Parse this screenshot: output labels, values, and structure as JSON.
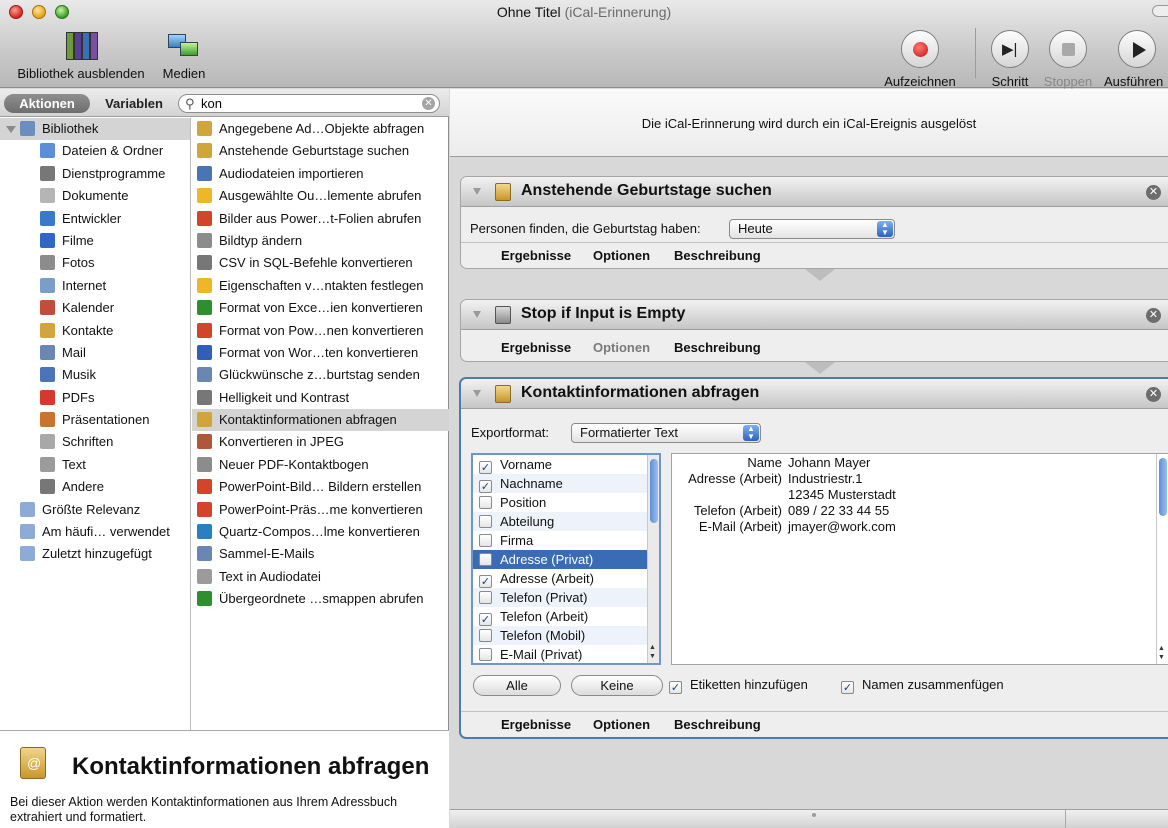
{
  "window": {
    "title": "Ohne Titel",
    "subtitle": "(iCal-Erinnerung)"
  },
  "toolbar": {
    "library_label": "Bibliothek ausblenden",
    "media_label": "Medien",
    "record_label": "Aufzeichnen",
    "step_label": "Schritt",
    "stop_label": "Stoppen",
    "run_label": "Ausführen"
  },
  "sidebar": {
    "tab_actions": "Aktionen",
    "tab_variables": "Variablen",
    "search_value": "kon",
    "categories": [
      {
        "label": "Bibliothek",
        "icon": "library-icon",
        "color": "#6a8fbf"
      },
      {
        "label": "Dateien & Ordner",
        "icon": "finder-icon",
        "color": "#5c8ed8"
      },
      {
        "label": "Dienstprogramme",
        "icon": "utilities-icon",
        "color": "#777777"
      },
      {
        "label": "Dokumente",
        "icon": "document-icon",
        "color": "#b5b5b5"
      },
      {
        "label": "Entwickler",
        "icon": "developer-icon",
        "color": "#3a78c8"
      },
      {
        "label": "Filme",
        "icon": "quicktime-icon",
        "color": "#2f67c2"
      },
      {
        "label": "Fotos",
        "icon": "photos-icon",
        "color": "#8c8c8c"
      },
      {
        "label": "Internet",
        "icon": "globe-icon",
        "color": "#7a9ec8"
      },
      {
        "label": "Kalender",
        "icon": "calendar-icon",
        "color": "#c54b3c"
      },
      {
        "label": "Kontakte",
        "icon": "address-book-icon",
        "color": "#d1a43c"
      },
      {
        "label": "Mail",
        "icon": "mail-icon",
        "color": "#6a86b5"
      },
      {
        "label": "Musik",
        "icon": "music-icon",
        "color": "#4a74b8"
      },
      {
        "label": "PDFs",
        "icon": "pdf-icon",
        "color": "#d23b2b"
      },
      {
        "label": "Präsentationen",
        "icon": "presentation-icon",
        "color": "#c9742a"
      },
      {
        "label": "Schriften",
        "icon": "fonts-icon",
        "color": "#a8a8a8"
      },
      {
        "label": "Text",
        "icon": "text-icon",
        "color": "#9b9b9b"
      },
      {
        "label": "Andere",
        "icon": "other-icon",
        "color": "#777777"
      }
    ],
    "smart_groups": [
      {
        "label": "Größte Relevanz",
        "icon": "smart-folder-icon",
        "color": "#8eaad6"
      },
      {
        "label": "Am häufi… verwendet",
        "icon": "smart-folder-icon",
        "color": "#8eaad6"
      },
      {
        "label": "Zuletzt hinzugefügt",
        "icon": "smart-folder-icon",
        "color": "#8eaad6"
      }
    ],
    "actions": [
      {
        "label": "Angegebene Ad…Objekte abfragen",
        "icon": "address-book-icon",
        "color": "#d1a43c"
      },
      {
        "label": "Anstehende Geburtstage suchen",
        "icon": "address-book-icon",
        "color": "#d1a43c"
      },
      {
        "label": "Audiodateien importieren",
        "icon": "itunes-icon",
        "color": "#4a74b8"
      },
      {
        "label": "Ausgewählte Ou…lemente abrufen",
        "icon": "outlook-icon",
        "color": "#f0b62a"
      },
      {
        "label": "Bilder aus Power…t-Folien abrufen",
        "icon": "powerpoint-icon",
        "color": "#d2452b"
      },
      {
        "label": "Bildtyp ändern",
        "icon": "preview-icon",
        "color": "#8c8c8c"
      },
      {
        "label": "CSV in SQL-Befehle konvertieren",
        "icon": "utilities-icon",
        "color": "#777777"
      },
      {
        "label": "Eigenschaften v…ntakten festlegen",
        "icon": "outlook-icon",
        "color": "#f0b62a"
      },
      {
        "label": "Format von Exce…ien konvertieren",
        "icon": "excel-icon",
        "color": "#2e8f2e"
      },
      {
        "label": "Format von Pow…nen konvertieren",
        "icon": "powerpoint-icon",
        "color": "#d2452b"
      },
      {
        "label": "Format von Wor…ten konvertieren",
        "icon": "word-icon",
        "color": "#2f5fb8"
      },
      {
        "label": "Glückwünsche z…burtstag senden",
        "icon": "mail-icon",
        "color": "#6a86b5"
      },
      {
        "label": "Helligkeit und Kontrast",
        "icon": "utilities-icon",
        "color": "#777777"
      },
      {
        "label": "Kontaktinformationen abfragen",
        "icon": "address-book-icon",
        "color": "#d1a43c"
      },
      {
        "label": "Konvertieren in JPEG",
        "icon": "image-icon",
        "color": "#b0573a"
      },
      {
        "label": "Neuer PDF-Kontaktbogen",
        "icon": "preview-icon",
        "color": "#8c8c8c"
      },
      {
        "label": "PowerPoint-Bild… Bildern erstellen",
        "icon": "powerpoint-icon",
        "color": "#d2452b"
      },
      {
        "label": "PowerPoint-Präs…me konvertieren",
        "icon": "powerpoint-icon",
        "color": "#d2452b"
      },
      {
        "label": "Quartz-Compos…lme konvertieren",
        "icon": "quartz-icon",
        "color": "#2a7fc0"
      },
      {
        "label": "Sammel-E-Mails",
        "icon": "mail-icon",
        "color": "#6a86b5"
      },
      {
        "label": "Text in Audiodatei",
        "icon": "text-icon",
        "color": "#9b9b9b"
      },
      {
        "label": "Übergeordnete …smappen abrufen",
        "icon": "excel-icon",
        "color": "#2e8f2e"
      }
    ],
    "selected_action": "Kontaktinformationen abfragen"
  },
  "description": {
    "title": "Kontaktinformationen abfragen",
    "text": "Bei dieser Aktion werden Kontaktinformationen aus Ihrem Adressbuch extrahiert und formatiert."
  },
  "workflow": {
    "trigger_text": "Die iCal-Erinnerung wird durch ein iCal-Ereignis ausgelöst",
    "tabs": {
      "results": "Ergebnisse",
      "options": "Optionen",
      "description": "Beschreibung"
    },
    "block1": {
      "title": "Anstehende Geburtstage suchen",
      "field_label": "Personen finden, die Geburtstag haben:",
      "popup_value": "Heute"
    },
    "block2": {
      "title": "Stop if Input is Empty"
    },
    "block3": {
      "title": "Kontaktinformationen abfragen",
      "export_label": "Exportformat:",
      "export_value": "Formatierter Text",
      "fields": [
        {
          "label": "Vorname",
          "checked": true
        },
        {
          "label": "Nachname",
          "checked": true
        },
        {
          "label": "Position",
          "checked": false
        },
        {
          "label": "Abteilung",
          "checked": false
        },
        {
          "label": "Firma",
          "checked": false
        },
        {
          "label": "Adresse (Privat)",
          "checked": false
        },
        {
          "label": "Adresse (Arbeit)",
          "checked": true
        },
        {
          "label": "Telefon (Privat)",
          "checked": false
        },
        {
          "label": "Telefon (Arbeit)",
          "checked": true
        },
        {
          "label": "Telefon (Mobil)",
          "checked": false
        },
        {
          "label": "E-Mail (Privat)",
          "checked": false
        }
      ],
      "selected_field": "Adresse (Privat)",
      "preview": [
        {
          "key": "Name",
          "value": "Johann Mayer"
        },
        {
          "key": "Adresse (Arbeit)",
          "value": "Industriestr.1"
        },
        {
          "key": "",
          "value": "12345 Musterstadt"
        },
        {
          "key": "Telefon (Arbeit)",
          "value": "089 / 22 33 44 55"
        },
        {
          "key": "E-Mail (Arbeit)",
          "value": "jmayer@work.com"
        }
      ],
      "all_button": "Alle",
      "none_button": "Keine",
      "add_labels": "Etiketten hinzufügen",
      "merge_names": "Namen zusammenfügen"
    }
  }
}
